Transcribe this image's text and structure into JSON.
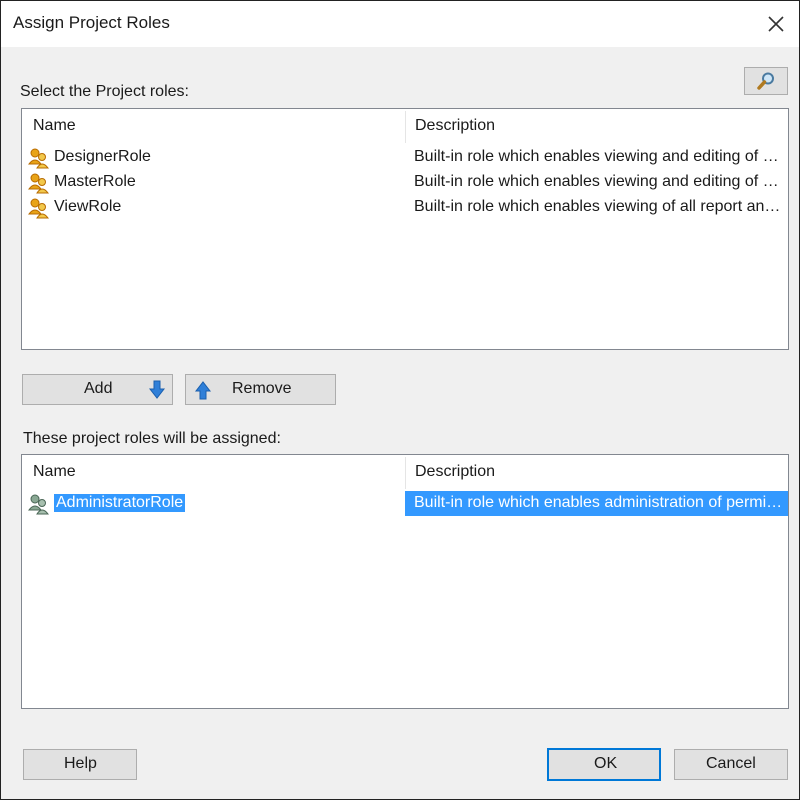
{
  "dialog": {
    "title": "Assign Project Roles",
    "close_icon": "close-icon"
  },
  "available": {
    "label": "Select the Project roles:",
    "search_icon": "magnifier-icon",
    "columns": [
      "Name",
      "Description"
    ],
    "rows": [
      {
        "name": "DesignerRole",
        "description": "Built-in role which enables viewing and editing of a...",
        "icon": "role-icon"
      },
      {
        "name": "MasterRole",
        "description": "Built-in role which enables viewing and editing of a...",
        "icon": "role-icon"
      },
      {
        "name": "ViewRole",
        "description": "Built-in role which enables viewing of all report and...",
        "icon": "role-icon"
      }
    ]
  },
  "actions": {
    "add_label": "Add",
    "remove_label": "Remove",
    "add_icon": "arrow-down-icon",
    "remove_icon": "arrow-up-icon"
  },
  "assigned": {
    "label": "These project roles will be assigned:",
    "columns": [
      "Name",
      "Description"
    ],
    "rows": [
      {
        "name": "AdministratorRole",
        "description": "Built-in role which enables administration of permis...",
        "icon": "admin-role-icon",
        "selected": true
      }
    ]
  },
  "footer": {
    "help_label": "Help",
    "ok_label": "OK",
    "cancel_label": "Cancel"
  },
  "colors": {
    "selection": "#3399ff",
    "accent": "#0078d7",
    "role_icon": "#e8a317",
    "admin_icon": "#5f7f6a"
  }
}
